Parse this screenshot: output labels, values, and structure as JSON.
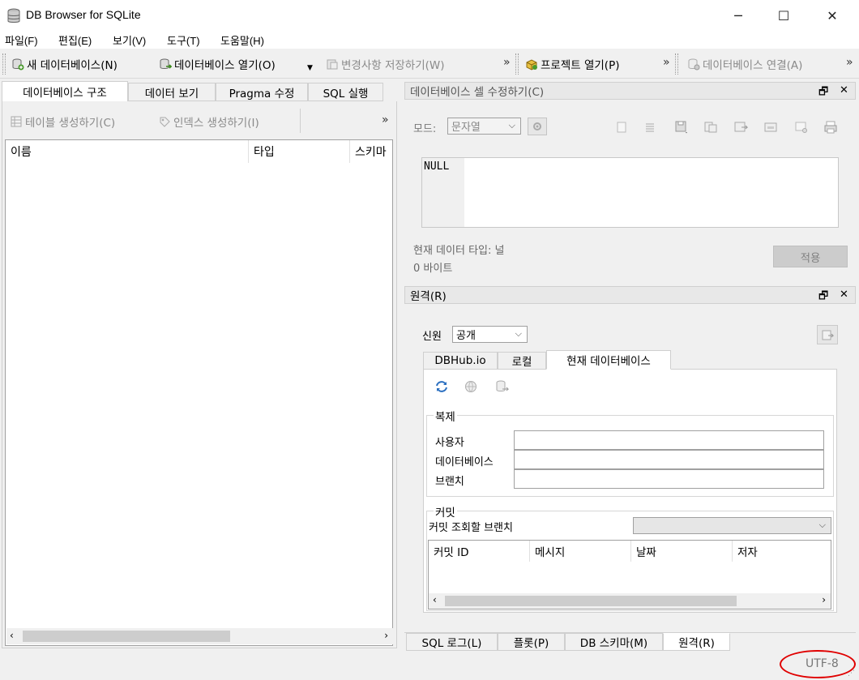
{
  "window": {
    "title": "DB Browser for SQLite",
    "minimize": "─",
    "maximize": "☐",
    "close": "✕"
  },
  "menu": [
    "파일(F)",
    "편집(E)",
    "보기(V)",
    "도구(T)",
    "도움말(H)"
  ],
  "toolbar": {
    "new_db": "새 데이터베이스(N)",
    "open_db": "데이터베이스 열기(O)",
    "save_changes": "변경사항 저장하기(W)",
    "open_project": "프로젝트 열기(P)",
    "attach_db": "데이터베이스 연결(A)",
    "more": "»"
  },
  "left": {
    "tabs": [
      "데이터베이스 구조",
      "데이터 보기",
      "Pragma 수정",
      "SQL 실행"
    ],
    "create_table": "테이블 생성하기(C)",
    "create_index": "인덱스 생성하기(I)",
    "more": "»",
    "columns": [
      "이름",
      "타입",
      "스키마"
    ]
  },
  "edit_cell": {
    "title": "데이터베이스 셀 수정하기(C)",
    "mode_label": "모드:",
    "mode_value": "문자열",
    "cell_value": "NULL",
    "type_label": "현재 데이터 타입: 널",
    "size_label": "0 바이트",
    "apply": "적용"
  },
  "remote": {
    "title": "원격(R)",
    "identity_label": "신원",
    "identity_value": "공개",
    "tabs": [
      "DBHub.io",
      "로컬",
      "현재 데이터베이스"
    ],
    "clone_group": "복제",
    "user_label": "사용자",
    "db_label": "데이터베이스",
    "branch_label": "브랜치",
    "commits_group": "커밋",
    "commit_branch_label": "커밋 조회할 브랜치",
    "commit_columns": [
      "커밋 ID",
      "메시지",
      "날짜",
      "저자"
    ]
  },
  "bottom_tabs": [
    "SQL 로그(L)",
    "플롯(P)",
    "DB 스키마(M)",
    "원격(R)"
  ],
  "status": {
    "encoding": "UTF-8"
  },
  "colors": {
    "highlight_circle": "#e00000"
  }
}
